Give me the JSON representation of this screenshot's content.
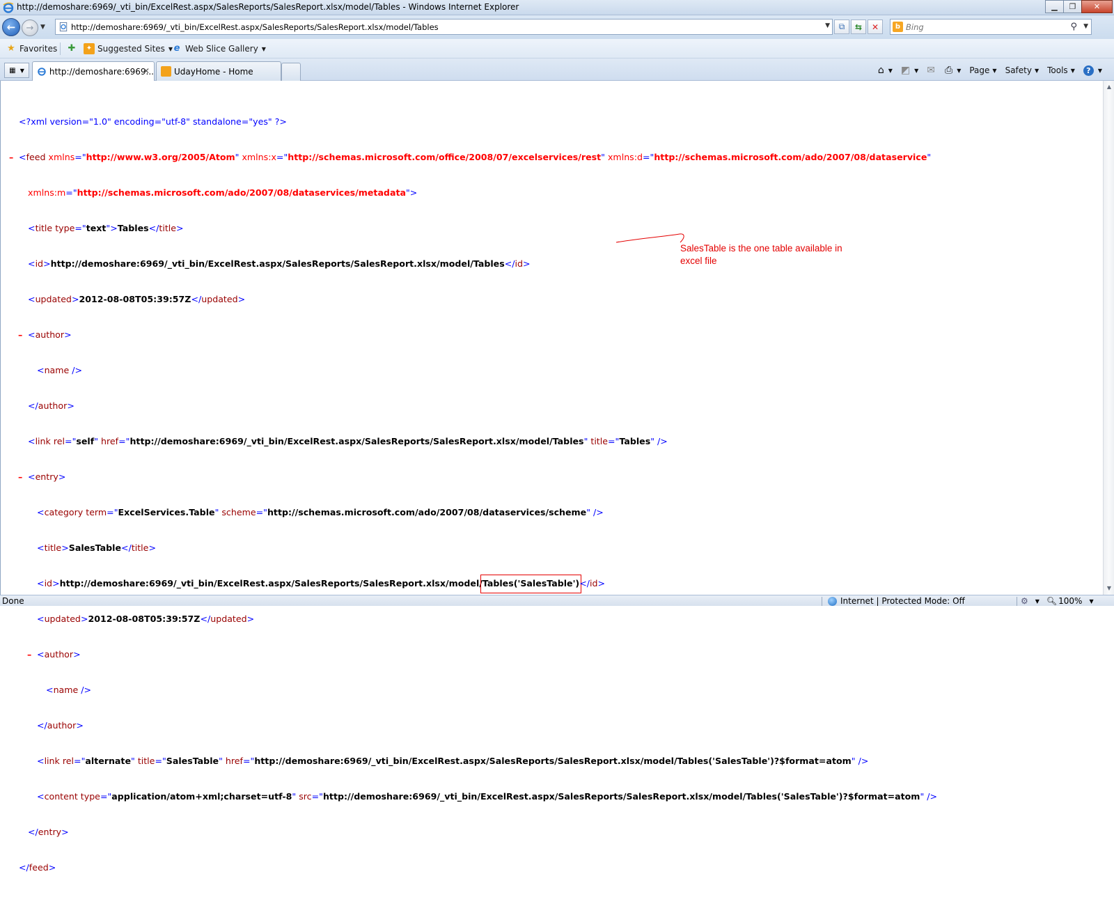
{
  "window": {
    "title": "http://demoshare:6969/_vti_bin/ExcelRest.aspx/SalesReports/SalesReport.xlsx/model/Tables - Windows Internet Explorer",
    "minimize": "▁",
    "restore": "❐",
    "close": "✕"
  },
  "nav": {
    "back_symbol": "←",
    "forward_symbol": "→",
    "address": "http://demoshare:6969/_vti_bin/ExcelRest.aspx/SalesReports/SalesReport.xlsx/model/Tables",
    "search_placeholder": "Bing"
  },
  "favorites": {
    "favorites_label": "Favorites",
    "suggested_sites_label": "Suggested Sites",
    "web_slice_gallery_label": "Web Slice Gallery"
  },
  "tabs": [
    {
      "label": "http://demoshare:6969...",
      "active": true
    },
    {
      "label": "UdayHome - Home",
      "active": false
    }
  ],
  "commandbar": {
    "page_label": "Page",
    "safety_label": "Safety",
    "tools_label": "Tools"
  },
  "xml": {
    "l1": "<?xml version=\"1.0\" encoding=\"utf-8\" standalone=\"yes\" ?>",
    "feed_ns_atom": "http://www.w3.org/2005/Atom",
    "feed_ns_x": "http://schemas.microsoft.com/office/2008/07/excelservices/rest",
    "feed_ns_d": "http://schemas.microsoft.com/ado/2007/08/dataservice",
    "feed_ns_m": "http://schemas.microsoft.com/ado/2007/08/dataservices/metadata",
    "title_type": "text",
    "title_text": "Tables",
    "id_text": "http://demoshare:6969/_vti_bin/ExcelRest.aspx/SalesReports/SalesReport.xlsx/model/Tables",
    "updated_text": "2012-08-08T05:39:57Z",
    "link_rel": "self",
    "link_href": "http://demoshare:6969/_vti_bin/ExcelRest.aspx/SalesReports/SalesReport.xlsx/model/Tables",
    "link_title": "Tables",
    "category_term": "ExcelServices.Table",
    "category_scheme": "http://schemas.microsoft.com/ado/2007/08/dataservices/scheme",
    "entry_title_text": "SalesTable",
    "entry_id_prefix": "http://demoshare:6969/_vti_bin/ExcelRest.aspx/SalesReports/SalesReport.xlsx/model/",
    "entry_id_highlight": "Tables('SalesTable')",
    "entry_updated_text": "2012-08-08T05:39:57Z",
    "entry_link_rel": "alternate",
    "entry_link_title": "SalesTable",
    "entry_link_href": "http://demoshare:6969/_vti_bin/ExcelRest.aspx/SalesReports/SalesReport.xlsx/model/Tables('SalesTable')?$format=atom",
    "content_type": "application/atom+xml;charset=utf-8",
    "content_src": "http://demoshare:6969/_vti_bin/ExcelRest.aspx/SalesReports/SalesReport.xlsx/model/Tables('SalesTable')?$format=atom"
  },
  "annotation": "SalesTable is the one table available in excel file",
  "status": {
    "done": "Done",
    "zone": "Internet | Protected Mode: Off",
    "zoom": "100%"
  },
  "colors": {
    "tag": "#990000",
    "pi": "#0000ff",
    "ns_value": "#ff0000",
    "annotation": "#e40000"
  }
}
